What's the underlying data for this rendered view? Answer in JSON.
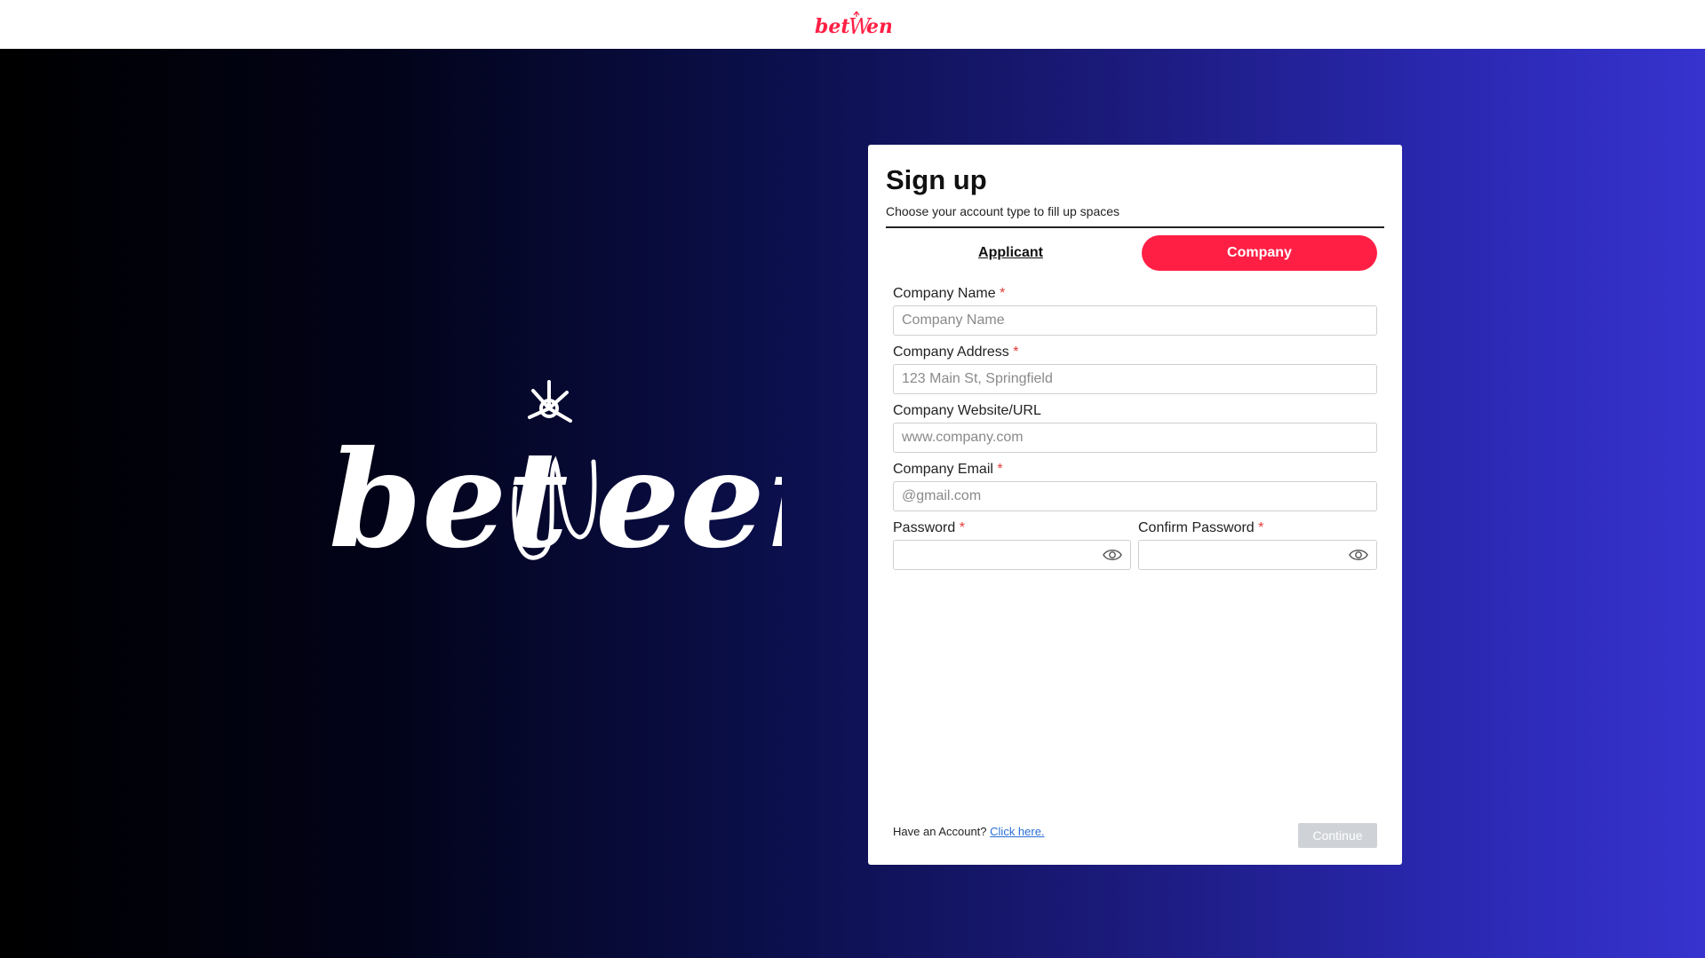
{
  "brand": {
    "logo_text": "betWeen",
    "accent_color": "#ff1f45"
  },
  "signup": {
    "title": "Sign up",
    "subtitle": "Choose your account type to fill up spaces",
    "tabs": [
      {
        "label": "Applicant",
        "active": false
      },
      {
        "label": "Company",
        "active": true
      }
    ],
    "fields": {
      "company_name": {
        "label": "Company Name",
        "required": "*",
        "placeholder": "Company Name",
        "value": ""
      },
      "company_address": {
        "label": "Company Address",
        "required": "*",
        "placeholder": "123 Main St, Springfield",
        "value": ""
      },
      "company_website": {
        "label": "Company Website/URL",
        "placeholder": "www.company.com",
        "value": ""
      },
      "company_email": {
        "label": "Company Email",
        "required": "*",
        "placeholder": "@gmail.com",
        "value": ""
      },
      "password": {
        "label": "Password",
        "required": "*",
        "value": ""
      },
      "confirm_password": {
        "label": "Confirm Password",
        "required": "*",
        "value": ""
      }
    },
    "footer": {
      "have_account_text": "Have an Account?",
      "link_text": "Click here."
    },
    "continue_label": "Continue"
  }
}
